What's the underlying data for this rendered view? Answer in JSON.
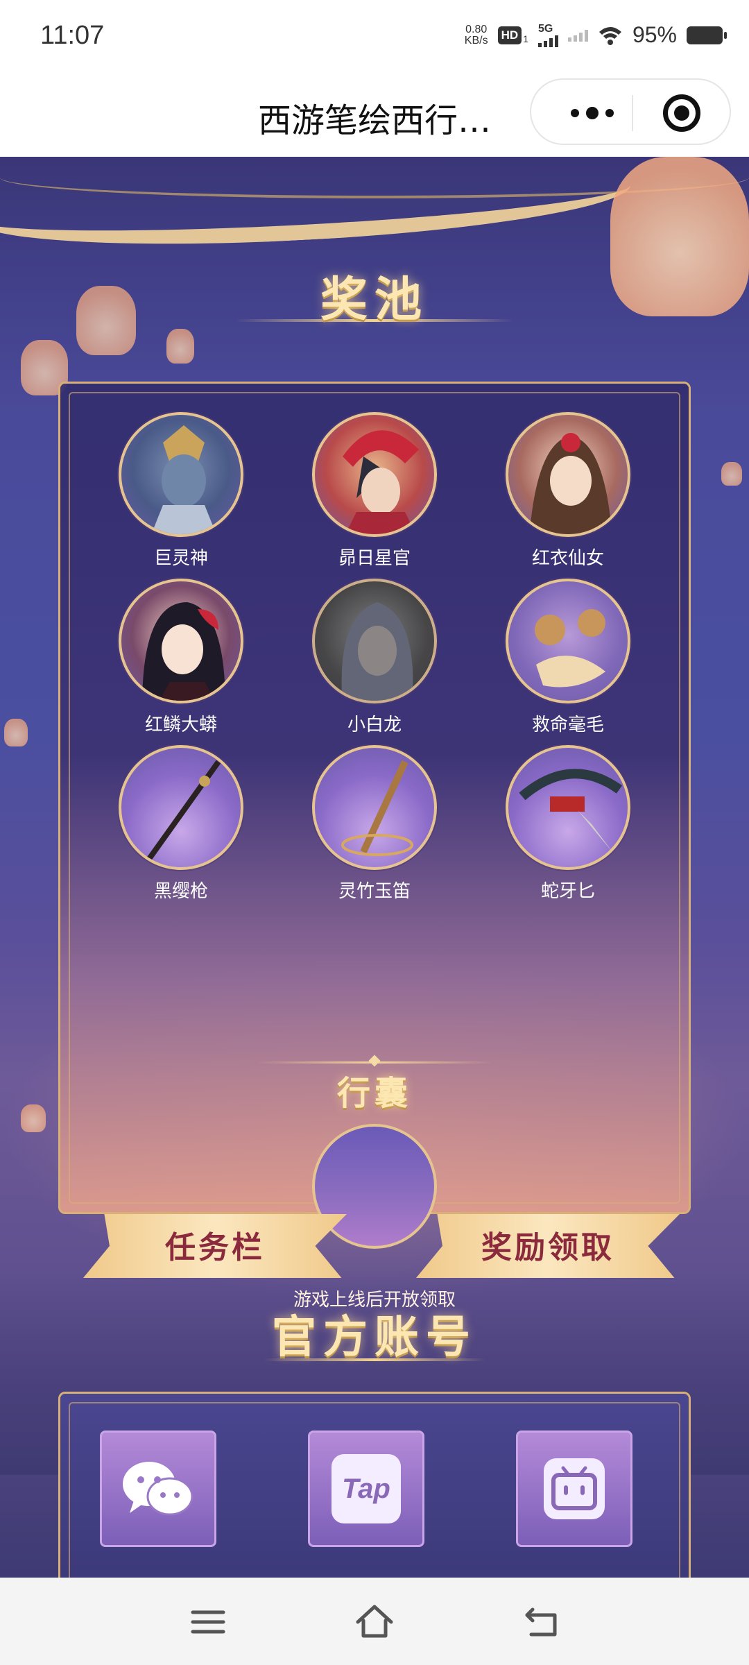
{
  "status_bar": {
    "time": "11:07",
    "net_speed_value": "0.80",
    "net_speed_unit": "KB/s",
    "hd_badge": "HD",
    "hd_sub": "1",
    "network": "5G",
    "battery_percent": "95%"
  },
  "navbar": {
    "title": "西游笔绘西行…",
    "more_icon": "more-dots-icon",
    "close_icon": "target-close-icon"
  },
  "pool": {
    "title": "奖池",
    "characters": [
      {
        "name": "巨灵神",
        "icon": "giant-spirit-portrait"
      },
      {
        "name": "昴日星官",
        "icon": "rooster-star-portrait"
      },
      {
        "name": "红衣仙女",
        "icon": "red-fairy-portrait"
      },
      {
        "name": "红鳞大蟒",
        "icon": "red-python-portrait"
      },
      {
        "name": "小白龙",
        "icon": "white-dragon-portrait"
      },
      {
        "name": "救命毫毛",
        "icon": "life-hair-portrait"
      },
      {
        "name": "黑缨枪",
        "icon": "black-spear-portrait"
      },
      {
        "name": "灵竹玉笛",
        "icon": "jade-flute-portrait"
      },
      {
        "name": "蛇牙匕",
        "icon": "snake-dagger-portrait"
      }
    ],
    "bag_title": "行囊",
    "bag_note": "游戏上线后开放领取"
  },
  "buttons": {
    "tasks": "任务栏",
    "rewards": "奖励领取"
  },
  "accounts": {
    "title": "官方账号",
    "items": [
      {
        "icon": "wechat-icon"
      },
      {
        "icon": "taptap-icon",
        "label": "Tap"
      },
      {
        "icon": "bilibili-icon"
      }
    ]
  },
  "bottom_nav": {
    "items": [
      "menu-icon",
      "home-icon",
      "back-icon"
    ]
  },
  "colors": {
    "gold_border": "#d8b077",
    "title_gold": "#fce7b2",
    "flag_text": "#8a2a3c",
    "bg_purple": "#4a4a9a"
  }
}
